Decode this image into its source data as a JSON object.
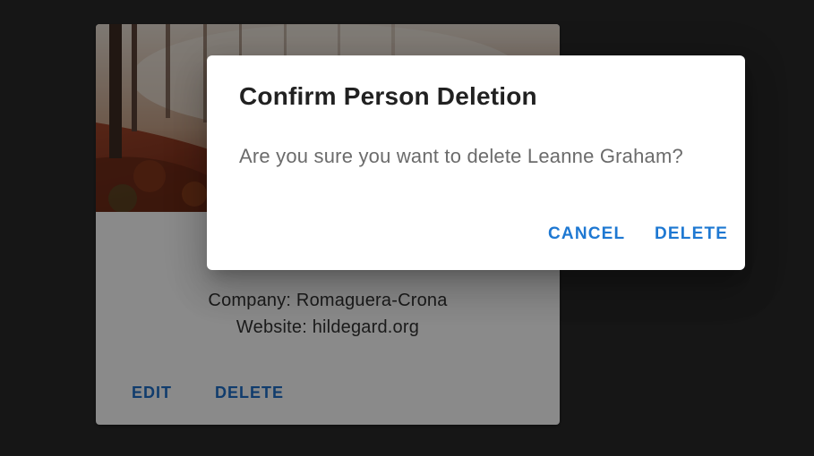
{
  "card": {
    "image_name": "autumn-forest-photo",
    "company": "Company: Romaguera-Crona",
    "website": "Website: hildegard.org",
    "edit_label": "EDIT",
    "delete_label": "DELETE"
  },
  "dialog": {
    "title": "Confirm Person Deletion",
    "message": "Are you sure you want to delete Leanne Graham?",
    "cancel_label": "CANCEL",
    "delete_label": "DELETE"
  },
  "colors": {
    "accent": "#1e78d2",
    "backdrop": "#181818",
    "dialog_bg": "#ffffff"
  }
}
